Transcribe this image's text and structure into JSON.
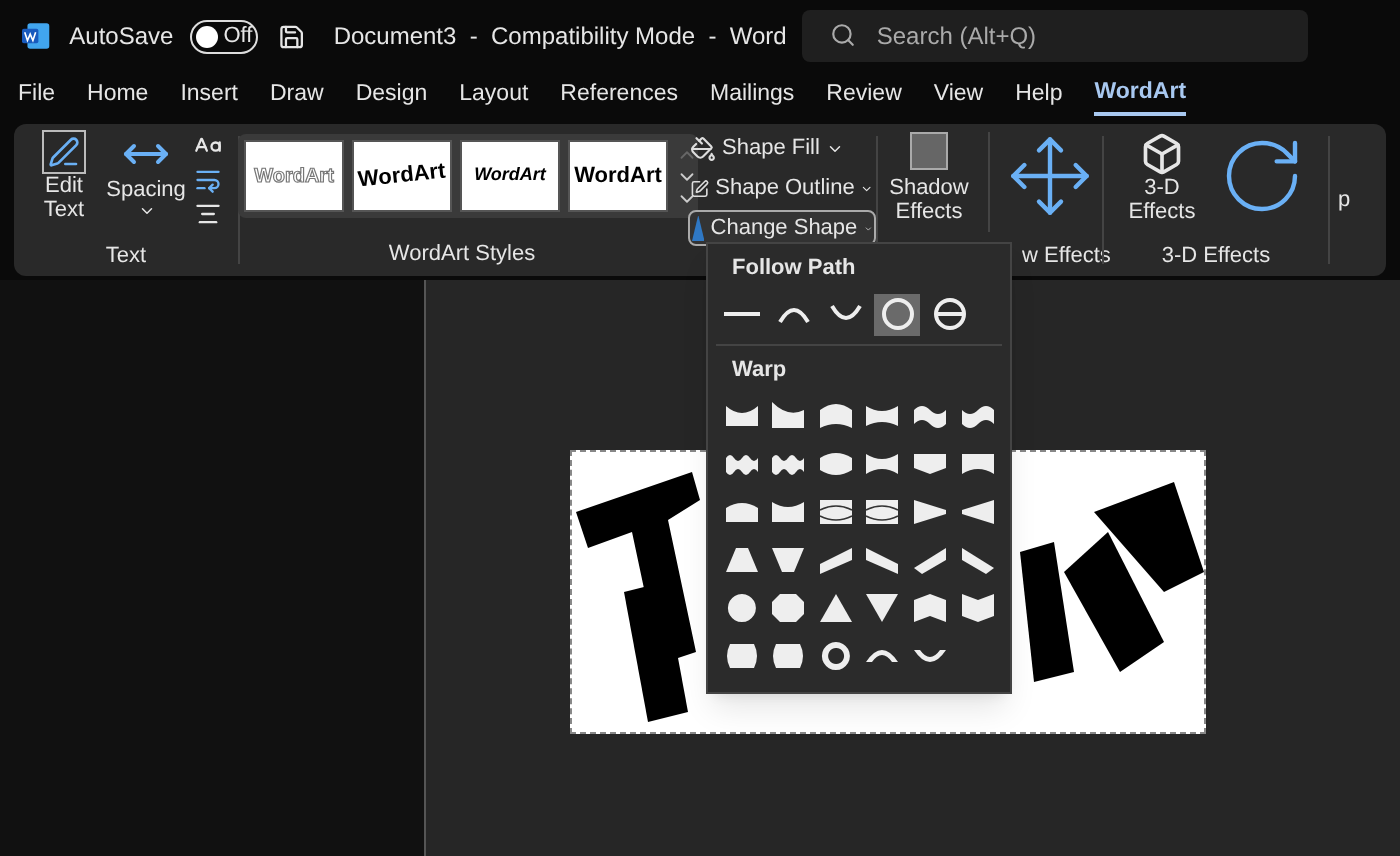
{
  "title_bar": {
    "autosave_label": "AutoSave",
    "autosave": {
      "on": false,
      "label": "Off"
    },
    "document_title": "Document3  -  Compatibility Mode  -  Word",
    "search": {
      "placeholder": "Search (Alt+Q)"
    }
  },
  "tabs": [
    {
      "label": "File",
      "selected": false
    },
    {
      "label": "Home",
      "selected": false
    },
    {
      "label": "Insert",
      "selected": false
    },
    {
      "label": "Draw",
      "selected": false
    },
    {
      "label": "Design",
      "selected": false
    },
    {
      "label": "Layout",
      "selected": false
    },
    {
      "label": "References",
      "selected": false
    },
    {
      "label": "Mailings",
      "selected": false
    },
    {
      "label": "Review",
      "selected": false
    },
    {
      "label": "View",
      "selected": false
    },
    {
      "label": "Help",
      "selected": false
    },
    {
      "label": "WordArt",
      "selected": true
    }
  ],
  "ribbon": {
    "text_group": {
      "label": "Text",
      "buttons": [
        "Edit Text",
        "Spacing"
      ]
    },
    "styles_group": {
      "label": "WordArt Styles",
      "styles": [
        {
          "text": "WordArt",
          "kind": "outline"
        },
        {
          "text": "WordArt",
          "kind": "arch"
        },
        {
          "text": "WordArt",
          "kind": "curve"
        },
        {
          "text": "WordArt",
          "kind": "bulge"
        }
      ]
    },
    "shape_buttons": [
      {
        "label": "Shape Fill",
        "open": false
      },
      {
        "label": "Shape Outline",
        "open": false
      },
      {
        "label": "Change Shape",
        "open": true
      }
    ],
    "shadow_group": {
      "button": "Shadow Effects",
      "label": "w Effects"
    },
    "three_d_group": {
      "button": "3-D Effects",
      "label": "3-D Effects"
    },
    "cut_label": "p"
  },
  "menu": {
    "sections": [
      {
        "title": "Follow Path",
        "items": [
          {
            "kind": "line",
            "selected": false
          },
          {
            "kind": "arch-up",
            "selected": false
          },
          {
            "kind": "arch-down",
            "selected": false
          },
          {
            "kind": "circle",
            "selected": true
          },
          {
            "kind": "button",
            "selected": false
          }
        ]
      },
      {
        "title": "Warp",
        "items": [
          {
            "kind": "concave-top",
            "selected": false
          },
          {
            "kind": "concave-top-tall",
            "selected": false
          },
          {
            "kind": "arch-top",
            "selected": false
          },
          {
            "kind": "pinch-top",
            "selected": false
          },
          {
            "kind": "wave",
            "selected": false
          },
          {
            "kind": "wave-rev",
            "selected": false
          },
          {
            "kind": "double-wave",
            "selected": false
          },
          {
            "kind": "double-wave",
            "selected": false
          },
          {
            "kind": "inflate",
            "selected": false
          },
          {
            "kind": "deflate",
            "selected": false
          },
          {
            "kind": "chevron-down",
            "selected": false
          },
          {
            "kind": "bend-bottom",
            "selected": false
          },
          {
            "kind": "inflate-top",
            "selected": false
          },
          {
            "kind": "deflate-top",
            "selected": false
          },
          {
            "kind": "wave-lines-up",
            "selected": false
          },
          {
            "kind": "wave-lines-both",
            "selected": false
          },
          {
            "kind": "fade-right",
            "selected": false
          },
          {
            "kind": "fade-left",
            "selected": false
          },
          {
            "kind": "fade-up",
            "selected": false
          },
          {
            "kind": "fade-down",
            "selected": false
          },
          {
            "kind": "slant-up",
            "selected": false
          },
          {
            "kind": "slant-down",
            "selected": false
          },
          {
            "kind": "cascade-up",
            "selected": false
          },
          {
            "kind": "cascade-down",
            "selected": false
          },
          {
            "kind": "button-warp",
            "selected": false
          },
          {
            "kind": "octagon",
            "selected": false
          },
          {
            "kind": "triangle-up",
            "selected": false
          },
          {
            "kind": "triangle-down",
            "selected": false
          },
          {
            "kind": "chevron-up-shape",
            "selected": false
          },
          {
            "kind": "chevron-down-shape",
            "selected": false
          },
          {
            "kind": "button-pour",
            "selected": false
          },
          {
            "kind": "button-pour",
            "selected": false
          },
          {
            "kind": "ring",
            "selected": false
          },
          {
            "kind": "arch-up-thick",
            "selected": false
          },
          {
            "kind": "arch-down-thick",
            "selected": false
          }
        ]
      }
    ]
  }
}
